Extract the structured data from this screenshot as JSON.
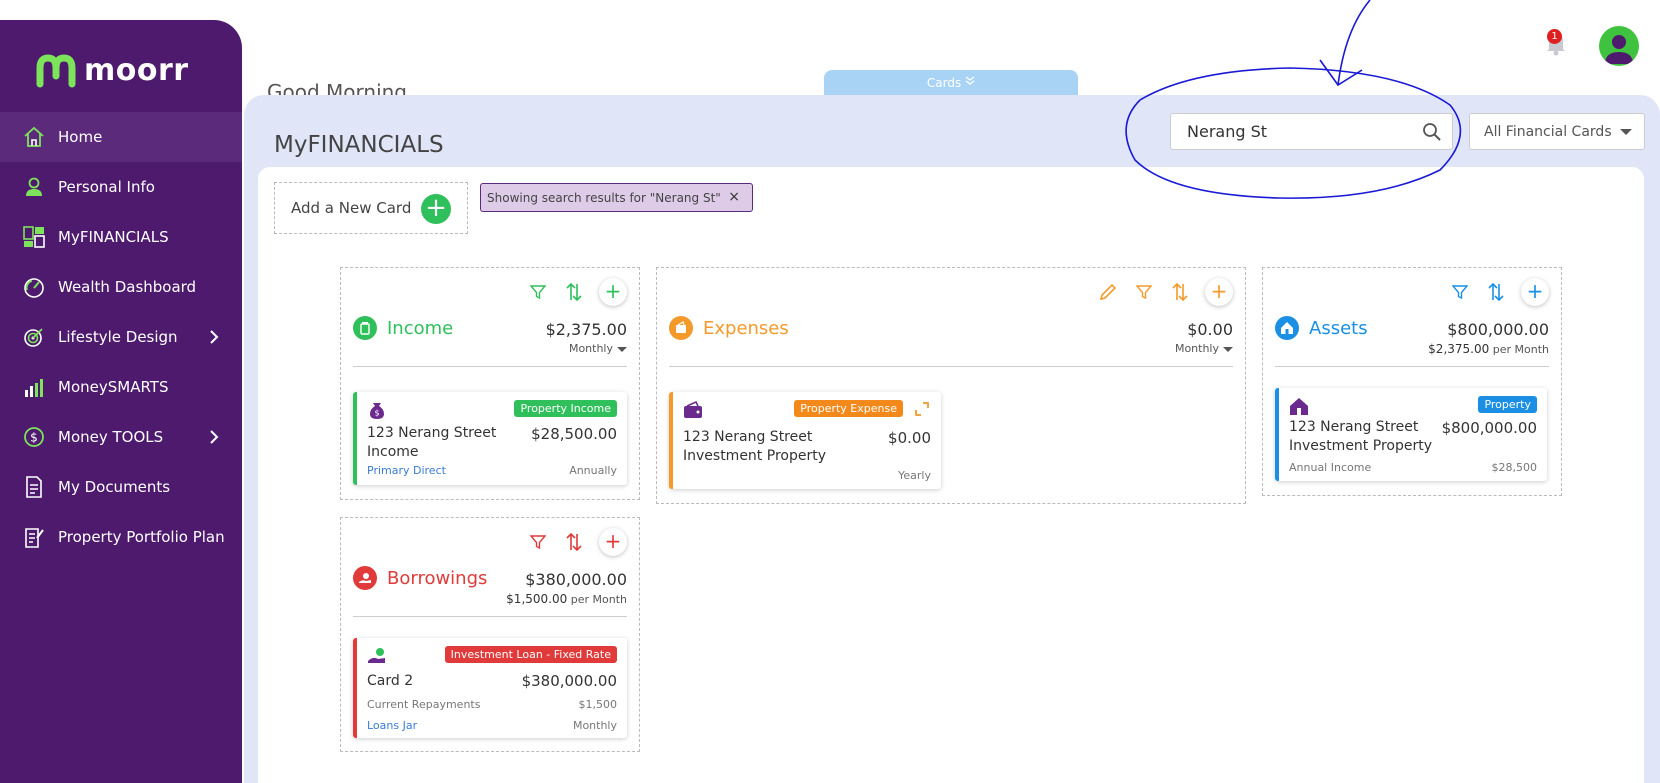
{
  "app": {
    "logo_text": "moorr",
    "greeting": "Good Morning",
    "cards_tab": "Cards",
    "notifications_count": "1"
  },
  "sidebar": {
    "items": [
      {
        "label": "Home"
      },
      {
        "label": "Personal Info"
      },
      {
        "label": "MyFINANCIALS"
      },
      {
        "label": "Wealth Dashboard"
      },
      {
        "label": "Lifestyle Design"
      },
      {
        "label": "MoneySMARTS"
      },
      {
        "label": "Money TOOLS"
      },
      {
        "label": "My Documents"
      },
      {
        "label": "Property Portfolio Plan"
      }
    ]
  },
  "main": {
    "title": "MyFINANCIALS",
    "search_value": "Nerang St",
    "filter_select": "All Financial Cards",
    "add_card_label": "Add a New Card",
    "search_chip": "Showing search results for \"Nerang St\"",
    "chip_close": "×"
  },
  "groups": {
    "income": {
      "title": "Income",
      "amount": "$2,375.00",
      "period": "Monthly",
      "card": {
        "badge": "Property Income",
        "name": "123 Nerang Street Income",
        "value": "$28,500.00",
        "foot_left": "Primary Direct",
        "foot_right": "Annually"
      }
    },
    "expenses": {
      "title": "Expenses",
      "amount": "$0.00",
      "period": "Monthly",
      "card": {
        "badge": "Property Expense",
        "name": "123 Nerang Street Investment Property",
        "value": "$0.00",
        "foot_right": "Yearly"
      }
    },
    "assets": {
      "title": "Assets",
      "amount": "$800,000.00",
      "sub_amount": "$2,375.00",
      "sub_unit": "per Month",
      "card": {
        "badge": "Property",
        "name": "123 Nerang Street Investment Property",
        "value": "$800,000.00",
        "foot_left": "Annual Income",
        "foot_right": "$28,500"
      }
    },
    "borrowings": {
      "title": "Borrowings",
      "amount": "$380,000.00",
      "sub_amount": "$1,500.00",
      "sub_unit": "per Month",
      "card": {
        "badge": "Investment Loan - Fixed Rate",
        "name": "Card 2",
        "value": "$380,000.00",
        "row2_left": "Current Repayments",
        "row2_right": "$1,500",
        "foot_left": "Loans Jar",
        "foot_right": "Monthly"
      }
    }
  },
  "colors": {
    "sidebar": "#4e1a6e",
    "income": "#2fbf5b",
    "expenses": "#f39a2b",
    "assets": "#1a8fe3",
    "borrowings": "#e03a3a",
    "annotation": "#1a1ad6"
  }
}
